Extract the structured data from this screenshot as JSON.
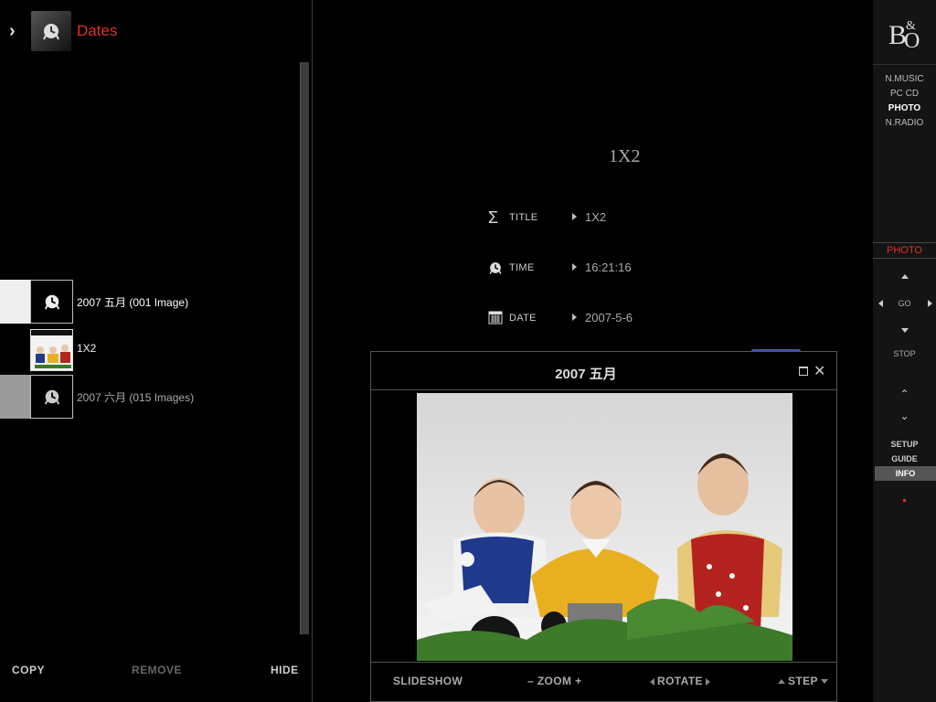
{
  "breadcrumb": {
    "title": "Dates",
    "icon": "clock-icon"
  },
  "list": [
    {
      "label": "2007 五月 (001 Image)",
      "icon": "clock-icon",
      "selected": true
    },
    {
      "label": "1X2",
      "icon": "photo-thumbnail"
    },
    {
      "label": "2007 六月 (015 Images)",
      "icon": "clock-icon"
    }
  ],
  "left_footer": {
    "copy": "COPY",
    "remove": "REMOVE",
    "hide": "HIDE"
  },
  "info": {
    "heading": "1X2",
    "rows": [
      {
        "key": "TITLE",
        "value": "1X2",
        "icon": "sigma-icon"
      },
      {
        "key": "TIME",
        "value": "16:21:16",
        "icon": "clock-icon"
      },
      {
        "key": "DATE",
        "value": "2007-5-6",
        "icon": "calendar-icon"
      }
    ]
  },
  "viewer": {
    "title": "2007 五月",
    "controls": {
      "slideshow": "SLIDESHOW",
      "zoom": "ZOOM",
      "rotate": "ROTATE",
      "step": "STEP"
    }
  },
  "sidebar": {
    "logo": "B&O",
    "sources": [
      "N.MUSIC",
      "PC CD",
      "PHOTO",
      "N.RADIO"
    ],
    "active_source": "PHOTO",
    "mode_label": "PHOTO",
    "go": "GO",
    "stop": "STOP",
    "menu": [
      "SETUP",
      "GUIDE",
      "INFO"
    ],
    "selected_menu": "INFO"
  },
  "colors": {
    "accent_red": "#e0312c",
    "background": "#000000",
    "sidebar_bg": "#141414"
  }
}
